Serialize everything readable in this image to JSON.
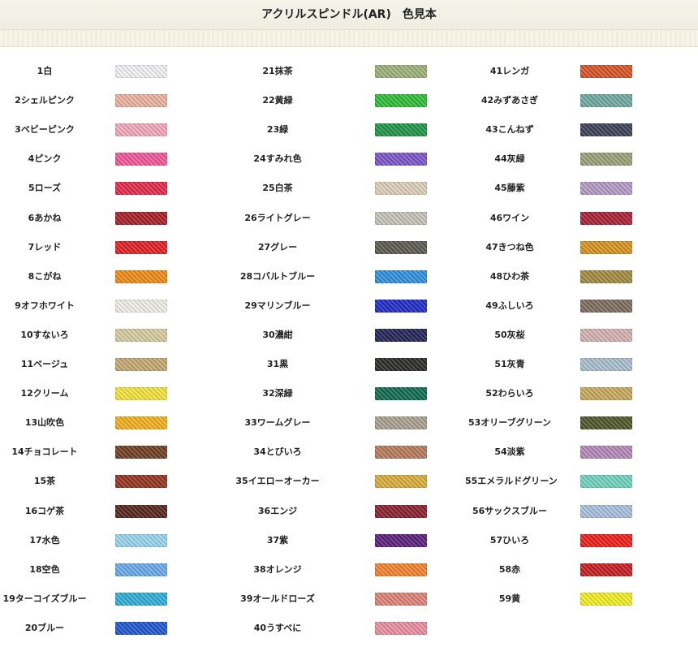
{
  "page": {
    "title": "アクリルスピンドル(AR)　色見本"
  },
  "colors": [
    {
      "label": "1白",
      "color": "#f4f4f6"
    },
    {
      "label": "2シェルピンク",
      "color": "#ecb3a0"
    },
    {
      "label": "3ベビーピンク",
      "color": "#f3a8bd"
    },
    {
      "label": "4ピンク",
      "color": "#f0579a"
    },
    {
      "label": "5ローズ",
      "color": "#e2284b"
    },
    {
      "label": "6あかね",
      "color": "#a81d24"
    },
    {
      "label": "7レッド",
      "color": "#e21e24"
    },
    {
      "label": "8こがね",
      "color": "#ef8a13"
    },
    {
      "label": "9オフホワイト",
      "color": "#f1efe9"
    },
    {
      "label": "10すないろ",
      "color": "#d6cda0"
    },
    {
      "label": "11ベージュ",
      "color": "#c7a871"
    },
    {
      "label": "12クリーム",
      "color": "#f4e43b"
    },
    {
      "label": "13山吹色",
      "color": "#f2b01c"
    },
    {
      "label": "14チョコレート",
      "color": "#6f3d20"
    },
    {
      "label": "15茶",
      "color": "#94321f"
    },
    {
      "label": "16コゲ茶",
      "color": "#55251a"
    },
    {
      "label": "17水色",
      "color": "#97d6ee"
    },
    {
      "label": "18空色",
      "color": "#6aa8ea"
    },
    {
      "label": "19ターコイズブルー",
      "color": "#2eaed6"
    },
    {
      "label": "20ブルー",
      "color": "#1f55d0"
    },
    {
      "label": "21抹茶",
      "color": "#9db278"
    },
    {
      "label": "22黄緑",
      "color": "#2dbd37"
    },
    {
      "label": "23緑",
      "color": "#1d9646"
    },
    {
      "label": "24すみれ色",
      "color": "#7b55c9"
    },
    {
      "label": "25白茶",
      "color": "#ddd0b8"
    },
    {
      "label": "26ライトグレー",
      "color": "#c7c3bb"
    },
    {
      "label": "27グレー",
      "color": "#5a5a52"
    },
    {
      "label": "28コバルトブルー",
      "color": "#2f8fde"
    },
    {
      "label": "29マリンブルー",
      "color": "#1e2bc8"
    },
    {
      "label": "30濃紺",
      "color": "#222257"
    },
    {
      "label": "31黒",
      "color": "#2a2a28"
    },
    {
      "label": "32深緑",
      "color": "#0f6b4f"
    },
    {
      "label": "33ワームグレー",
      "color": "#aaa08f"
    },
    {
      "label": "34とびいろ",
      "color": "#b77a5c"
    },
    {
      "label": "35イエローオーカー",
      "color": "#d9ad3a"
    },
    {
      "label": "36エンジ",
      "color": "#8b1f2e"
    },
    {
      "label": "37紫",
      "color": "#5b1f7c"
    },
    {
      "label": "38オレンジ",
      "color": "#f3822f"
    },
    {
      "label": "39オールドローズ",
      "color": "#dc8376"
    },
    {
      "label": "40うすべに",
      "color": "#ec8da0"
    },
    {
      "label": "41レンガ",
      "color": "#d95226"
    },
    {
      "label": "42みずあさぎ",
      "color": "#6fa9a2"
    },
    {
      "label": "43こんねず",
      "color": "#3b4056"
    },
    {
      "label": "44灰緑",
      "color": "#9aa07a"
    },
    {
      "label": "45藤紫",
      "color": "#b39ac6"
    },
    {
      "label": "46ワイン",
      "color": "#a82034"
    },
    {
      "label": "47きつね色",
      "color": "#d7931f"
    },
    {
      "label": "48ひわ茶",
      "color": "#a28a3e"
    },
    {
      "label": "49ふしいろ",
      "color": "#7e6b5f"
    },
    {
      "label": "50灰桜",
      "color": "#d6b1b1"
    },
    {
      "label": "51灰青",
      "color": "#a8bfd0"
    },
    {
      "label": "52わらいろ",
      "color": "#c8a85a"
    },
    {
      "label": "53オリーブグリーン",
      "color": "#4d5628"
    },
    {
      "label": "54淡紫",
      "color": "#b487b9"
    },
    {
      "label": "55エメラルドグリーン",
      "color": "#70d3be"
    },
    {
      "label": "56サックスブルー",
      "color": "#a7c0df"
    },
    {
      "label": "57ひいろ",
      "color": "#ee1d18"
    },
    {
      "label": "58赤",
      "color": "#c71b20"
    },
    {
      "label": "59黄",
      "color": "#f2ee22"
    }
  ]
}
